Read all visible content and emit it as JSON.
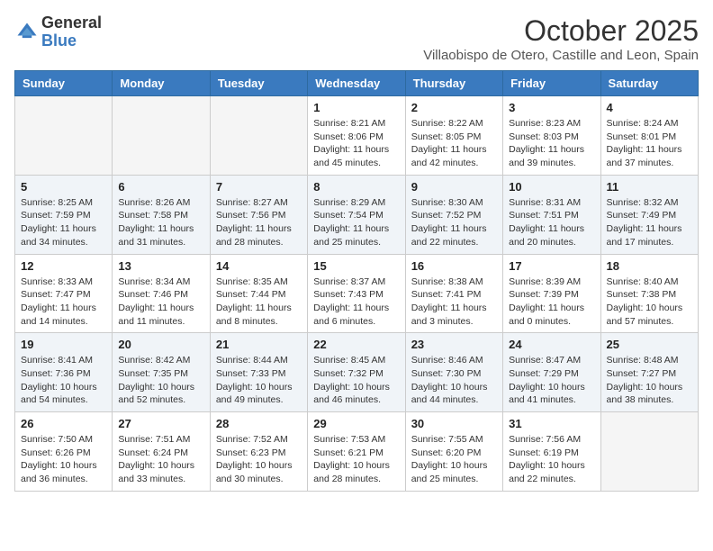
{
  "header": {
    "logo_general": "General",
    "logo_blue": "Blue",
    "month": "October 2025",
    "location": "Villaobispo de Otero, Castille and Leon, Spain"
  },
  "weekdays": [
    "Sunday",
    "Monday",
    "Tuesday",
    "Wednesday",
    "Thursday",
    "Friday",
    "Saturday"
  ],
  "weeks": [
    [
      {
        "day": "",
        "info": ""
      },
      {
        "day": "",
        "info": ""
      },
      {
        "day": "",
        "info": ""
      },
      {
        "day": "1",
        "info": "Sunrise: 8:21 AM\nSunset: 8:06 PM\nDaylight: 11 hours\nand 45 minutes."
      },
      {
        "day": "2",
        "info": "Sunrise: 8:22 AM\nSunset: 8:05 PM\nDaylight: 11 hours\nand 42 minutes."
      },
      {
        "day": "3",
        "info": "Sunrise: 8:23 AM\nSunset: 8:03 PM\nDaylight: 11 hours\nand 39 minutes."
      },
      {
        "day": "4",
        "info": "Sunrise: 8:24 AM\nSunset: 8:01 PM\nDaylight: 11 hours\nand 37 minutes."
      }
    ],
    [
      {
        "day": "5",
        "info": "Sunrise: 8:25 AM\nSunset: 7:59 PM\nDaylight: 11 hours\nand 34 minutes."
      },
      {
        "day": "6",
        "info": "Sunrise: 8:26 AM\nSunset: 7:58 PM\nDaylight: 11 hours\nand 31 minutes."
      },
      {
        "day": "7",
        "info": "Sunrise: 8:27 AM\nSunset: 7:56 PM\nDaylight: 11 hours\nand 28 minutes."
      },
      {
        "day": "8",
        "info": "Sunrise: 8:29 AM\nSunset: 7:54 PM\nDaylight: 11 hours\nand 25 minutes."
      },
      {
        "day": "9",
        "info": "Sunrise: 8:30 AM\nSunset: 7:52 PM\nDaylight: 11 hours\nand 22 minutes."
      },
      {
        "day": "10",
        "info": "Sunrise: 8:31 AM\nSunset: 7:51 PM\nDaylight: 11 hours\nand 20 minutes."
      },
      {
        "day": "11",
        "info": "Sunrise: 8:32 AM\nSunset: 7:49 PM\nDaylight: 11 hours\nand 17 minutes."
      }
    ],
    [
      {
        "day": "12",
        "info": "Sunrise: 8:33 AM\nSunset: 7:47 PM\nDaylight: 11 hours\nand 14 minutes."
      },
      {
        "day": "13",
        "info": "Sunrise: 8:34 AM\nSunset: 7:46 PM\nDaylight: 11 hours\nand 11 minutes."
      },
      {
        "day": "14",
        "info": "Sunrise: 8:35 AM\nSunset: 7:44 PM\nDaylight: 11 hours\nand 8 minutes."
      },
      {
        "day": "15",
        "info": "Sunrise: 8:37 AM\nSunset: 7:43 PM\nDaylight: 11 hours\nand 6 minutes."
      },
      {
        "day": "16",
        "info": "Sunrise: 8:38 AM\nSunset: 7:41 PM\nDaylight: 11 hours\nand 3 minutes."
      },
      {
        "day": "17",
        "info": "Sunrise: 8:39 AM\nSunset: 7:39 PM\nDaylight: 11 hours\nand 0 minutes."
      },
      {
        "day": "18",
        "info": "Sunrise: 8:40 AM\nSunset: 7:38 PM\nDaylight: 10 hours\nand 57 minutes."
      }
    ],
    [
      {
        "day": "19",
        "info": "Sunrise: 8:41 AM\nSunset: 7:36 PM\nDaylight: 10 hours\nand 54 minutes."
      },
      {
        "day": "20",
        "info": "Sunrise: 8:42 AM\nSunset: 7:35 PM\nDaylight: 10 hours\nand 52 minutes."
      },
      {
        "day": "21",
        "info": "Sunrise: 8:44 AM\nSunset: 7:33 PM\nDaylight: 10 hours\nand 49 minutes."
      },
      {
        "day": "22",
        "info": "Sunrise: 8:45 AM\nSunset: 7:32 PM\nDaylight: 10 hours\nand 46 minutes."
      },
      {
        "day": "23",
        "info": "Sunrise: 8:46 AM\nSunset: 7:30 PM\nDaylight: 10 hours\nand 44 minutes."
      },
      {
        "day": "24",
        "info": "Sunrise: 8:47 AM\nSunset: 7:29 PM\nDaylight: 10 hours\nand 41 minutes."
      },
      {
        "day": "25",
        "info": "Sunrise: 8:48 AM\nSunset: 7:27 PM\nDaylight: 10 hours\nand 38 minutes."
      }
    ],
    [
      {
        "day": "26",
        "info": "Sunrise: 7:50 AM\nSunset: 6:26 PM\nDaylight: 10 hours\nand 36 minutes."
      },
      {
        "day": "27",
        "info": "Sunrise: 7:51 AM\nSunset: 6:24 PM\nDaylight: 10 hours\nand 33 minutes."
      },
      {
        "day": "28",
        "info": "Sunrise: 7:52 AM\nSunset: 6:23 PM\nDaylight: 10 hours\nand 30 minutes."
      },
      {
        "day": "29",
        "info": "Sunrise: 7:53 AM\nSunset: 6:21 PM\nDaylight: 10 hours\nand 28 minutes."
      },
      {
        "day": "30",
        "info": "Sunrise: 7:55 AM\nSunset: 6:20 PM\nDaylight: 10 hours\nand 25 minutes."
      },
      {
        "day": "31",
        "info": "Sunrise: 7:56 AM\nSunset: 6:19 PM\nDaylight: 10 hours\nand 22 minutes."
      },
      {
        "day": "",
        "info": ""
      }
    ]
  ]
}
